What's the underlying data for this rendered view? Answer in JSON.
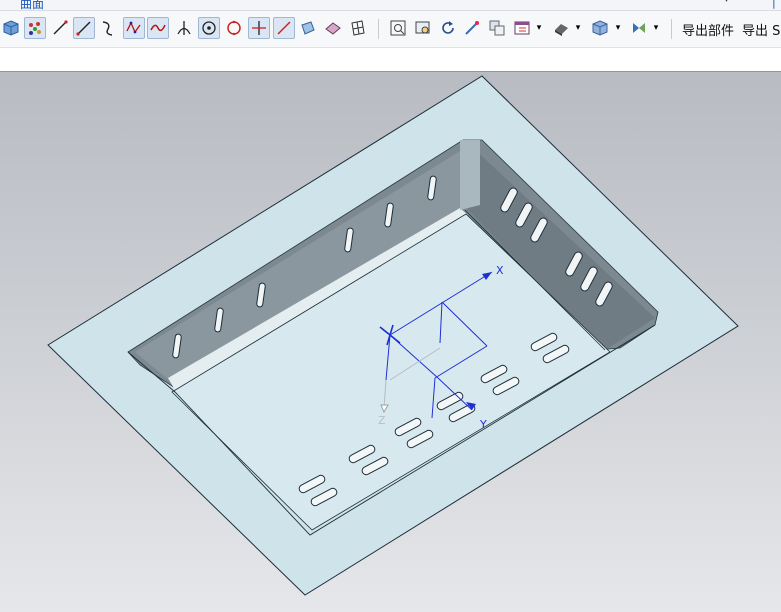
{
  "menu": {
    "partial_tab_label": "曲面"
  },
  "toolbar": {
    "export_part_label": "导出部件",
    "export_s_label": "导出 S"
  },
  "viewport": {
    "axes": {
      "x_label": "X",
      "y_label": "Y",
      "z_label": "Z"
    },
    "colors": {
      "plate": "#cfe3ea",
      "inner_wall": "#7d8a92",
      "axis": "#1f2fd6",
      "background_top": "#b8bcc2"
    }
  }
}
